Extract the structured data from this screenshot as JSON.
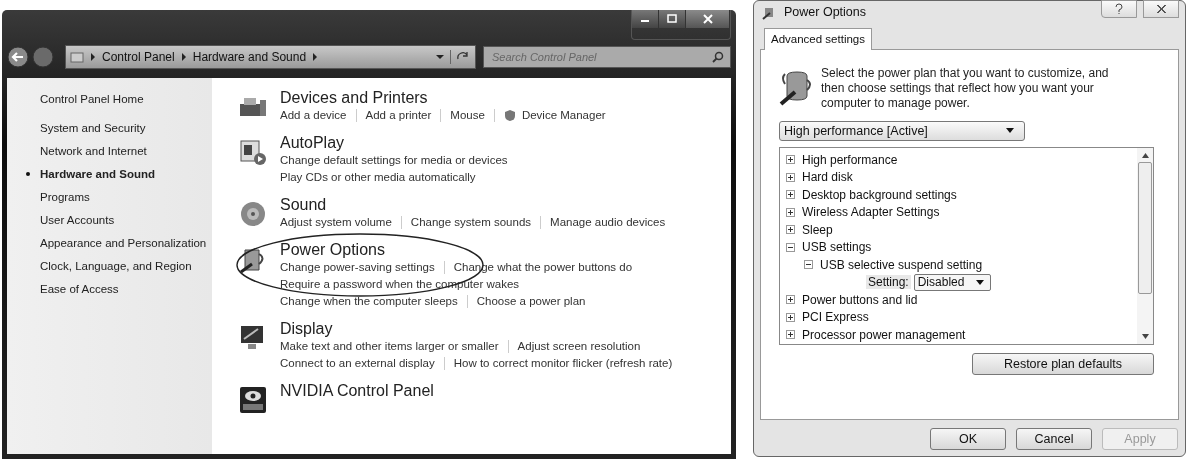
{
  "explorer": {
    "breadcrumb": [
      "Control Panel",
      "Hardware and Sound"
    ],
    "search": {
      "placeholder": "Search Control Panel"
    },
    "sidebar": [
      {
        "label": "Control Panel Home",
        "selected": false
      },
      {
        "label": "System and Security",
        "selected": false
      },
      {
        "label": "Network and Internet",
        "selected": false
      },
      {
        "label": "Hardware and Sound",
        "selected": true
      },
      {
        "label": "Programs",
        "selected": false
      },
      {
        "label": "User Accounts",
        "selected": false
      },
      {
        "label": "Appearance and Personalization",
        "selected": false
      },
      {
        "label": "Clock, Language, and Region",
        "selected": false
      },
      {
        "label": "Ease of Access",
        "selected": false
      }
    ],
    "categories": [
      {
        "kind": "printer",
        "title": "Devices and Printers",
        "circled": false,
        "lines": [
          [
            {
              "label": "Add a device",
              "shield": false
            },
            {
              "label": "Add a printer",
              "shield": false
            },
            {
              "label": "Mouse",
              "shield": false
            },
            {
              "label": "Device Manager",
              "shield": true
            }
          ]
        ]
      },
      {
        "kind": "autoplay",
        "title": "AutoPlay",
        "circled": false,
        "lines": [
          [
            {
              "label": "Change default settings for media or devices",
              "shield": false
            }
          ],
          [
            {
              "label": "Play CDs or other media automatically",
              "shield": false
            }
          ]
        ]
      },
      {
        "kind": "sound",
        "title": "Sound",
        "circled": false,
        "lines": [
          [
            {
              "label": "Adjust system volume",
              "shield": false
            },
            {
              "label": "Change system sounds",
              "shield": false
            },
            {
              "label": "Manage audio devices",
              "shield": false
            }
          ]
        ]
      },
      {
        "kind": "power",
        "title": "Power Options",
        "circled": true,
        "lines": [
          [
            {
              "label": "Change power-saving settings",
              "shield": false
            },
            {
              "label": "Change what the power buttons do",
              "shield": false
            }
          ],
          [
            {
              "label": "Require a password when the computer wakes",
              "shield": false
            }
          ],
          [
            {
              "label": "Change when the computer sleeps",
              "shield": false
            },
            {
              "label": "Choose a power plan",
              "shield": false
            }
          ]
        ]
      },
      {
        "kind": "display",
        "title": "Display",
        "circled": false,
        "lines": [
          [
            {
              "label": "Make text and other items larger or smaller",
              "shield": false
            },
            {
              "label": "Adjust screen resolution",
              "shield": false
            }
          ],
          [
            {
              "label": "Connect to an external display",
              "shield": false
            },
            {
              "label": "How to correct monitor flicker (refresh rate)",
              "shield": false
            }
          ]
        ]
      },
      {
        "kind": "nvidia",
        "title": "NVIDIA Control Panel",
        "circled": false
      }
    ]
  },
  "dialog": {
    "title": "Power Options",
    "tabs": [
      {
        "label": "Advanced settings",
        "selected": true
      }
    ],
    "intro": "Select the power plan that you want to customize, and then choose settings that reflect how you want your computer to manage power.",
    "plan": "High performance [Active]",
    "settings_tree": [
      {
        "kind": "group",
        "label": "High performance",
        "expanded": false
      },
      {
        "kind": "group",
        "label": "Hard disk",
        "expanded": false
      },
      {
        "kind": "group",
        "label": "Desktop background settings",
        "expanded": false
      },
      {
        "kind": "group",
        "label": "Wireless Adapter Settings",
        "expanded": false
      },
      {
        "kind": "group",
        "label": "Sleep",
        "expanded": false
      },
      {
        "kind": "group",
        "label": "USB settings",
        "expanded": true,
        "children": [
          {
            "kind": "group",
            "label": "USB selective suspend setting",
            "expanded": true,
            "children": [
              {
                "kind": "setting",
                "label": "Setting:",
                "value": "Disabled"
              }
            ]
          }
        ]
      },
      {
        "kind": "group",
        "label": "Power buttons and lid",
        "expanded": false
      },
      {
        "kind": "group",
        "label": "PCI Express",
        "expanded": false
      },
      {
        "kind": "group",
        "label": "Processor power management",
        "expanded": false
      }
    ],
    "restore_button": "Restore plan defaults",
    "buttons": [
      {
        "label": "OK",
        "disabled": false
      },
      {
        "label": "Cancel",
        "disabled": false
      },
      {
        "label": "Apply",
        "disabled": true
      }
    ]
  }
}
